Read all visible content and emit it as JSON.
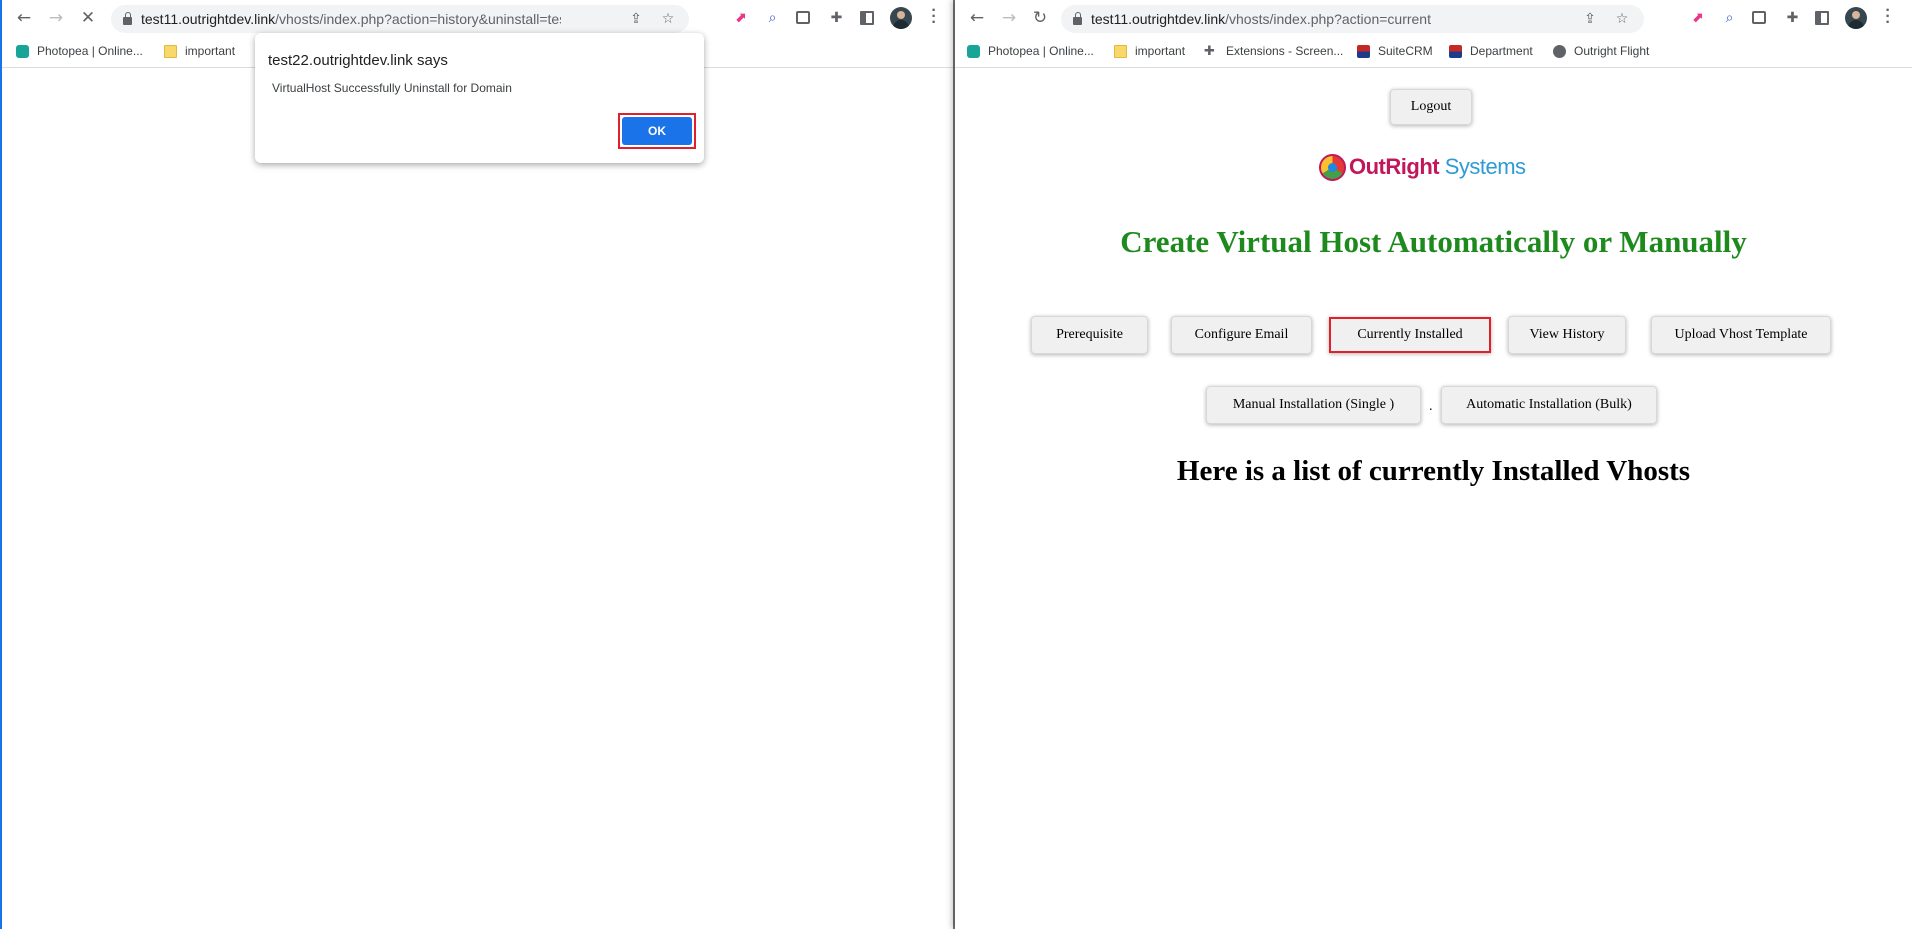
{
  "left_window": {
    "url_host": "test11.outrightdev.link",
    "url_path": "/vhosts/index.php?action=history&uninstall=test29.outri...",
    "bookmarks": [
      {
        "label": "Photopea | Online..."
      },
      {
        "label": "important"
      }
    ],
    "dialog": {
      "title": "test22.outrightdev.link says",
      "message": "VirtualHost Successfully Uninstall for Domain",
      "ok_label": "OK"
    }
  },
  "right_window": {
    "url_host": "test11.outrightdev.link",
    "url_path": "/vhosts/index.php?action=current",
    "bookmarks": [
      {
        "label": "Photopea | Online..."
      },
      {
        "label": "important"
      },
      {
        "label": "Extensions - Screen..."
      },
      {
        "label": "SuiteCRM"
      },
      {
        "label": "Department"
      },
      {
        "label": "Outright Flight"
      }
    ],
    "page": {
      "logout_label": "Logout",
      "logo_part1": "OutRight",
      "logo_part2": " Systems",
      "headline": "Create Virtual Host Automatically or Manually",
      "nav_row1": [
        {
          "label": "Prerequisite"
        },
        {
          "label": "Configure Email"
        },
        {
          "label": "Currently Installed"
        },
        {
          "label": "View History"
        },
        {
          "label": "Upload Vhost Template"
        }
      ],
      "nav_row2": [
        {
          "label": "Manual Installation (Single )"
        },
        {
          "label": "Automatic Installation (Bulk)"
        }
      ],
      "separator": ".",
      "subheading": "Here is a list of currently Installed Vhosts"
    }
  },
  "colors": {
    "headline_green": "#1e8a1e",
    "highlight_red": "#e0202a",
    "ok_blue": "#1a73e8"
  }
}
